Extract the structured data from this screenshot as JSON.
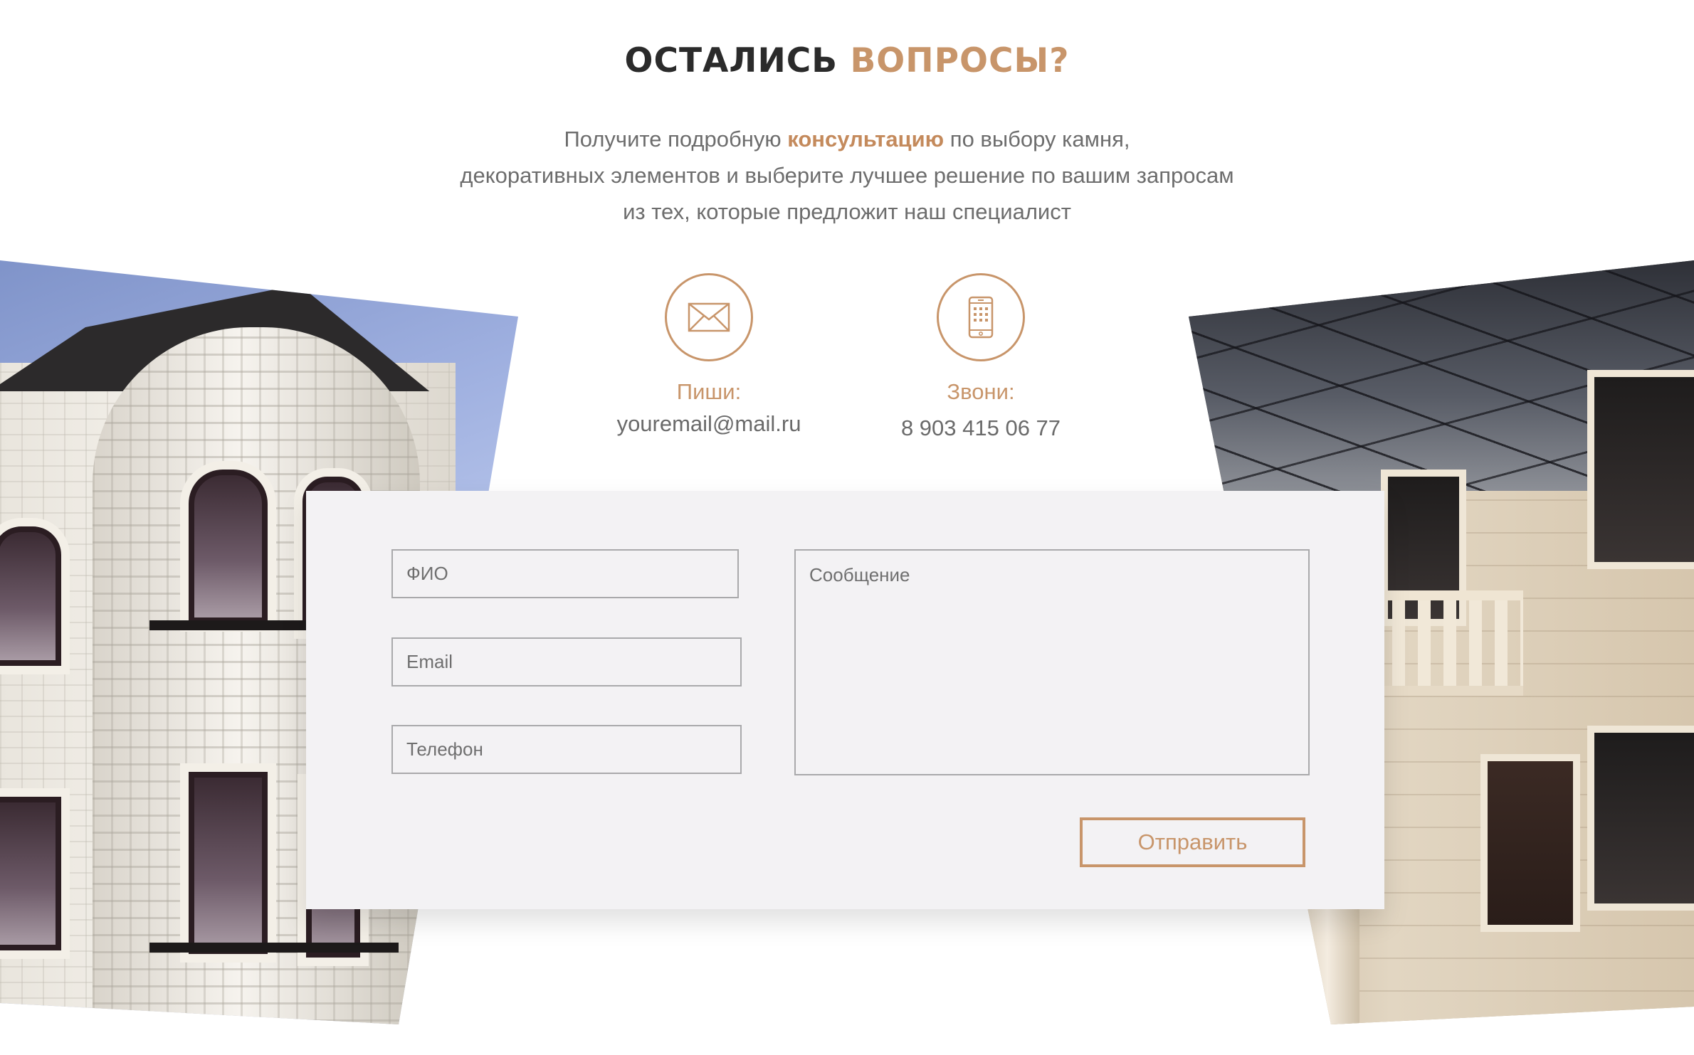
{
  "header": {
    "title_dark": "ОСТАЛИСЬ",
    "title_accent": "ВОПРОСЫ?",
    "lead_line1_pre": "Получите подробную",
    "lead_line1_highlight": "консультацию",
    "lead_line1_post": "по выбору камня,",
    "lead_line2": "декоративных элементов и выберите лучшее решение по вашим запросам",
    "lead_line3": "из тех, которые предложит наш специалист"
  },
  "contacts": {
    "mail": {
      "icon": "envelope-icon",
      "label": "Пиши:",
      "value": "youremail@mail.ru"
    },
    "phone": {
      "icon": "smartphone-icon",
      "label": "Звони:",
      "value": "8 903 415 06 77"
    }
  },
  "form": {
    "name_placeholder": "ФИО",
    "email_placeholder": "Email",
    "phone_placeholder": "Телефон",
    "message_placeholder": "Сообщение",
    "submit_label": "Отправить"
  },
  "colors": {
    "accent": "#c8956a",
    "heading": "#2b2b2b",
    "text": "#6d6d6d",
    "panel": "#f3f2f4"
  }
}
